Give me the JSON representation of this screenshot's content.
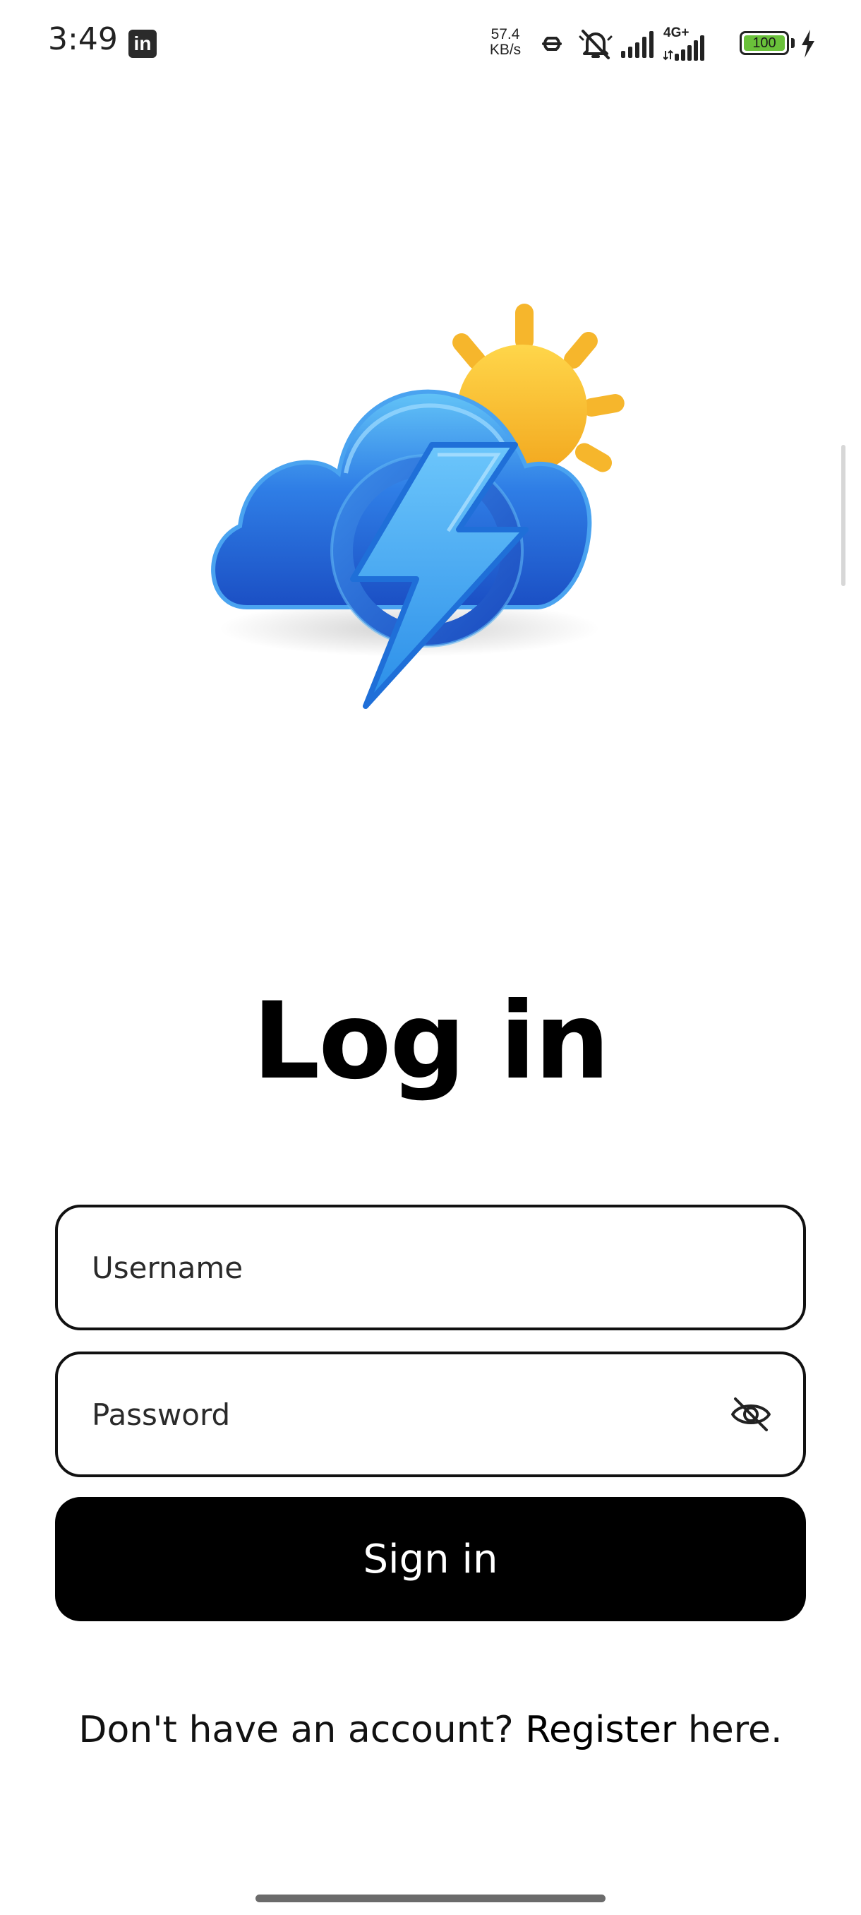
{
  "status_bar": {
    "time": "3:49",
    "app_badge": "in",
    "net_speed_value": "57.4",
    "net_speed_unit": "KB/s",
    "network_type": "4G+",
    "battery_level": "100",
    "icons": [
      "linkedin-icon",
      "link-icon",
      "mute-bell-icon",
      "signal-icon",
      "signal-4g-icon",
      "battery-icon",
      "charging-icon"
    ]
  },
  "logo": {
    "icon": "weather-cloud-sun-lightning-icon",
    "colors": {
      "cloud_light": "#5ab8f5",
      "cloud_dark": "#1f5fd1",
      "sun": "#f7c23a",
      "bolt": "#3fa6f5"
    }
  },
  "page": {
    "title": "Log in"
  },
  "form": {
    "username_placeholder": "Username",
    "password_placeholder": "Password",
    "password_toggle_icon": "eye-off-icon",
    "submit_label": "Sign in"
  },
  "footer": {
    "prompt": "Don't have an account? ",
    "register_link": "Register",
    "suffix": " here."
  },
  "colors": {
    "background": "#ffffff",
    "primary": "#000000",
    "button_text": "#ffffff"
  }
}
